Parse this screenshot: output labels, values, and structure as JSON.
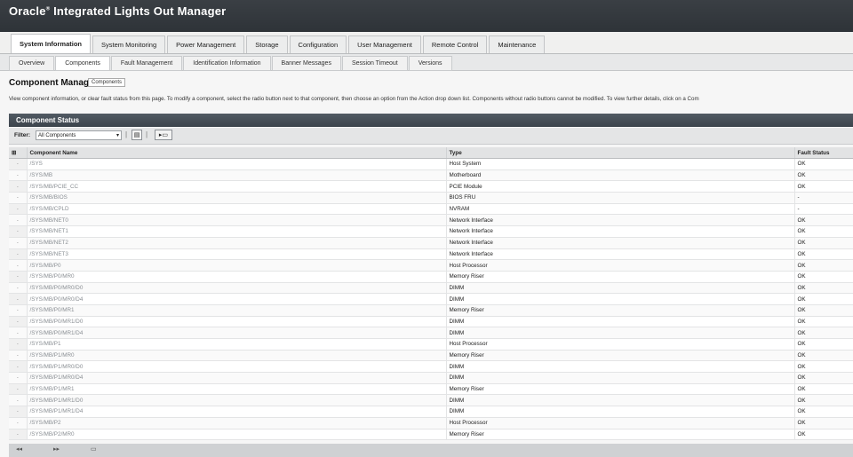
{
  "header": {
    "title": "Oracle",
    "title_mark": "®",
    "title_rest": " Integrated Lights Out Manager"
  },
  "main_tabs": [
    {
      "label": "System Information",
      "active": true
    },
    {
      "label": "System Monitoring",
      "active": false
    },
    {
      "label": "Power Management",
      "active": false
    },
    {
      "label": "Storage",
      "active": false
    },
    {
      "label": "Configuration",
      "active": false
    },
    {
      "label": "User Management",
      "active": false
    },
    {
      "label": "Remote Control",
      "active": false
    },
    {
      "label": "Maintenance",
      "active": false
    }
  ],
  "sub_tabs": [
    {
      "label": "Overview",
      "active": false
    },
    {
      "label": "Components",
      "active": true
    },
    {
      "label": "Fault Management",
      "active": false
    },
    {
      "label": "Identification Information",
      "active": false
    },
    {
      "label": "Banner Messages",
      "active": false
    },
    {
      "label": "Session Timeout",
      "active": false
    },
    {
      "label": "Versions",
      "active": false
    }
  ],
  "page": {
    "title": "Component Manag",
    "tooltip": "Components",
    "description": "View component information, or clear fault status from this page. To modify a component, select the radio button next to that component, then choose an option from the Action drop down list. Components without radio buttons cannot be modified. To view further details, click on a Com"
  },
  "section": {
    "title": "Component Status"
  },
  "filter": {
    "label": "Filter:",
    "value": "All Components"
  },
  "table": {
    "columns": [
      "Component Name",
      "Type",
      "Fault Status"
    ],
    "rows": [
      [
        "/SYS",
        "Host System",
        "OK"
      ],
      [
        "/SYS/MB",
        "Motherboard",
        "OK"
      ],
      [
        "/SYS/MB/PCIE_CC",
        "PCIE Module",
        "OK"
      ],
      [
        "/SYS/MB/BIOS",
        "BIOS FRU",
        "-"
      ],
      [
        "/SYS/MB/CPLD",
        "NVRAM",
        "-"
      ],
      [
        "/SYS/MB/NET0",
        "Network Interface",
        "OK"
      ],
      [
        "/SYS/MB/NET1",
        "Network Interface",
        "OK"
      ],
      [
        "/SYS/MB/NET2",
        "Network Interface",
        "OK"
      ],
      [
        "/SYS/MB/NET3",
        "Network Interface",
        "OK"
      ],
      [
        "/SYS/MB/P0",
        "Host Processor",
        "OK"
      ],
      [
        "/SYS/MB/P0/MR0",
        "Memory Riser",
        "OK"
      ],
      [
        "/SYS/MB/P0/MR0/D0",
        "DIMM",
        "OK"
      ],
      [
        "/SYS/MB/P0/MR0/D4",
        "DIMM",
        "OK"
      ],
      [
        "/SYS/MB/P0/MR1",
        "Memory Riser",
        "OK"
      ],
      [
        "/SYS/MB/P0/MR1/D0",
        "DIMM",
        "OK"
      ],
      [
        "/SYS/MB/P0/MR1/D4",
        "DIMM",
        "OK"
      ],
      [
        "/SYS/MB/P1",
        "Host Processor",
        "OK"
      ],
      [
        "/SYS/MB/P1/MR0",
        "Memory Riser",
        "OK"
      ],
      [
        "/SYS/MB/P1/MR0/D0",
        "DIMM",
        "OK"
      ],
      [
        "/SYS/MB/P1/MR0/D4",
        "DIMM",
        "OK"
      ],
      [
        "/SYS/MB/P1/MR1",
        "Memory Riser",
        "OK"
      ],
      [
        "/SYS/MB/P1/MR1/D0",
        "DIMM",
        "OK"
      ],
      [
        "/SYS/MB/P1/MR1/D4",
        "DIMM",
        "OK"
      ],
      [
        "/SYS/MB/P2",
        "Host Processor",
        "OK"
      ],
      [
        "/SYS/MB/P2/MR0",
        "Memory Riser",
        "OK"
      ]
    ]
  },
  "icons": {
    "header_select": "select-all-icon",
    "row_select": "row-radio-icon",
    "toolbar_action": "action-menu-icon",
    "toolbar_view": "view-toggle-icon"
  },
  "colors": {
    "header": "#2e3338",
    "section_bar": "#444c54",
    "accent_tab": "#ffffff"
  }
}
